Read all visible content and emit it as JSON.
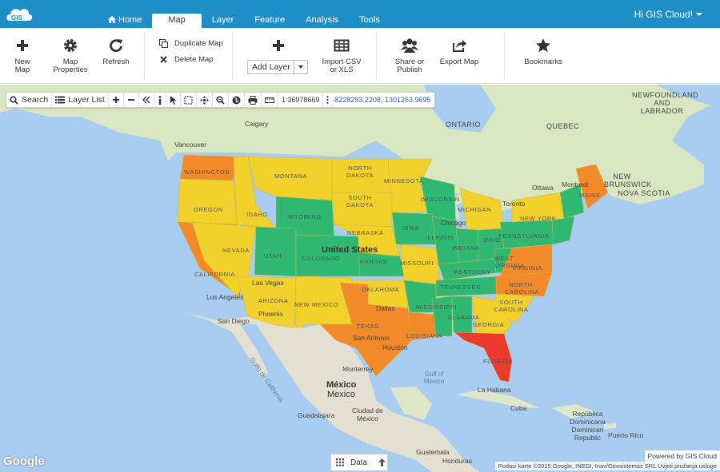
{
  "header": {
    "greeting": "Hi GIS Cloud!",
    "tabs": [
      {
        "label": "Home"
      },
      {
        "label": "Map"
      },
      {
        "label": "Layer"
      },
      {
        "label": "Feature"
      },
      {
        "label": "Analysis"
      },
      {
        "label": "Tools"
      }
    ],
    "active_tab": "Map",
    "logo_text": "GIS"
  },
  "ribbon": {
    "new_map": "New Map",
    "map_properties_1": "Map",
    "map_properties_2": "Properties",
    "refresh": "Refresh",
    "duplicate_map": "Duplicate Map",
    "delete_map": "Delete Map",
    "add_layer": "Add Layer",
    "import_1": "Import CSV",
    "import_2": "or XLS",
    "share_1": "Share or",
    "share_2": "Publish",
    "export_map": "Export Map",
    "bookmarks": "Bookmarks"
  },
  "map_toolbar": {
    "search": "Search",
    "layer_list": "Layer List",
    "scale": "1:36978669",
    "coordinates": "-8228293.2208, 1301263.9695"
  },
  "map_labels": {
    "states": [
      "WASHINGTON",
      "MONTANA",
      "NORTH DAKOTA",
      "MINNESOTA",
      "OREGON",
      "IDAHO",
      "WYOMING",
      "SOUTH DAKOTA",
      "WISCONSIN",
      "MICHIGAN",
      "NEVADA",
      "UTAH",
      "COLORADO",
      "NEBRASKA",
      "IOWA",
      "ILLINOIS",
      "INDIANA",
      "OHIO",
      "PENNSYLVANIA",
      "NEW YORK",
      "MAINE",
      "CALIFORNIA",
      "ARIZONA",
      "NEW MEXICO",
      "KANSAS",
      "MISSOURI",
      "KENTUCKY",
      "WEST VIRGINIA",
      "VIRGINIA",
      "OKLAHOMA",
      "TENNESSEE",
      "NORTH CAROLINA",
      "SOUTH CAROLINA",
      "TEXAS",
      "MISSISSIPPI",
      "ALABAMA",
      "GEORGIA",
      "LOUISIANA",
      "FLORIDA"
    ],
    "country_main": "United States",
    "provinces": [
      "ONTARIO",
      "QUEBEC",
      "NEWFOUNDLAND AND LABRADOR",
      "NEW BRUNSWICK",
      "NOVA SCOTIA"
    ],
    "cities": [
      "Calgary",
      "Vancouver",
      "Ottawa",
      "Montreal",
      "Toronto",
      "Chicago",
      "Las Vegas",
      "Los Angeles",
      "San Diego",
      "Phoenix",
      "Dallas",
      "San Antonio",
      "Houston",
      "Monterrey",
      "Guadalajara",
      "Mexico City",
      "La Habana",
      "Guatemala"
    ],
    "mexico_1": "México",
    "mexico_2": "Mexico",
    "ciudad_1": "Ciudad de",
    "ciudad_2": "México",
    "gulf_1": "Gulf of",
    "gulf_2": "Mexico",
    "golfo": "Golfo de California",
    "cuba": "Cuba",
    "honduras": "Honduras",
    "dr_1": "República",
    "dr_2": "Dominicana",
    "dr_3": "Dominican",
    "dr_4": "Republic",
    "puerto_rico": "Puerto Rico"
  },
  "footer": {
    "google": "Google",
    "data_button": "Data",
    "powered": "Powered by GIS Cloud",
    "attribution": "Podaci karte ©2015 Google, INEGI, Inav/Geosistemas SRL   Uvjeti pružanja usluge"
  },
  "colors": {
    "brand": "#1d8ec7",
    "green": "#2fb872",
    "yellow": "#f2d12a",
    "orange": "#f28a2a",
    "red": "#ea3b2e",
    "land": "#e9e5dc",
    "water": "#a8cdf0"
  }
}
